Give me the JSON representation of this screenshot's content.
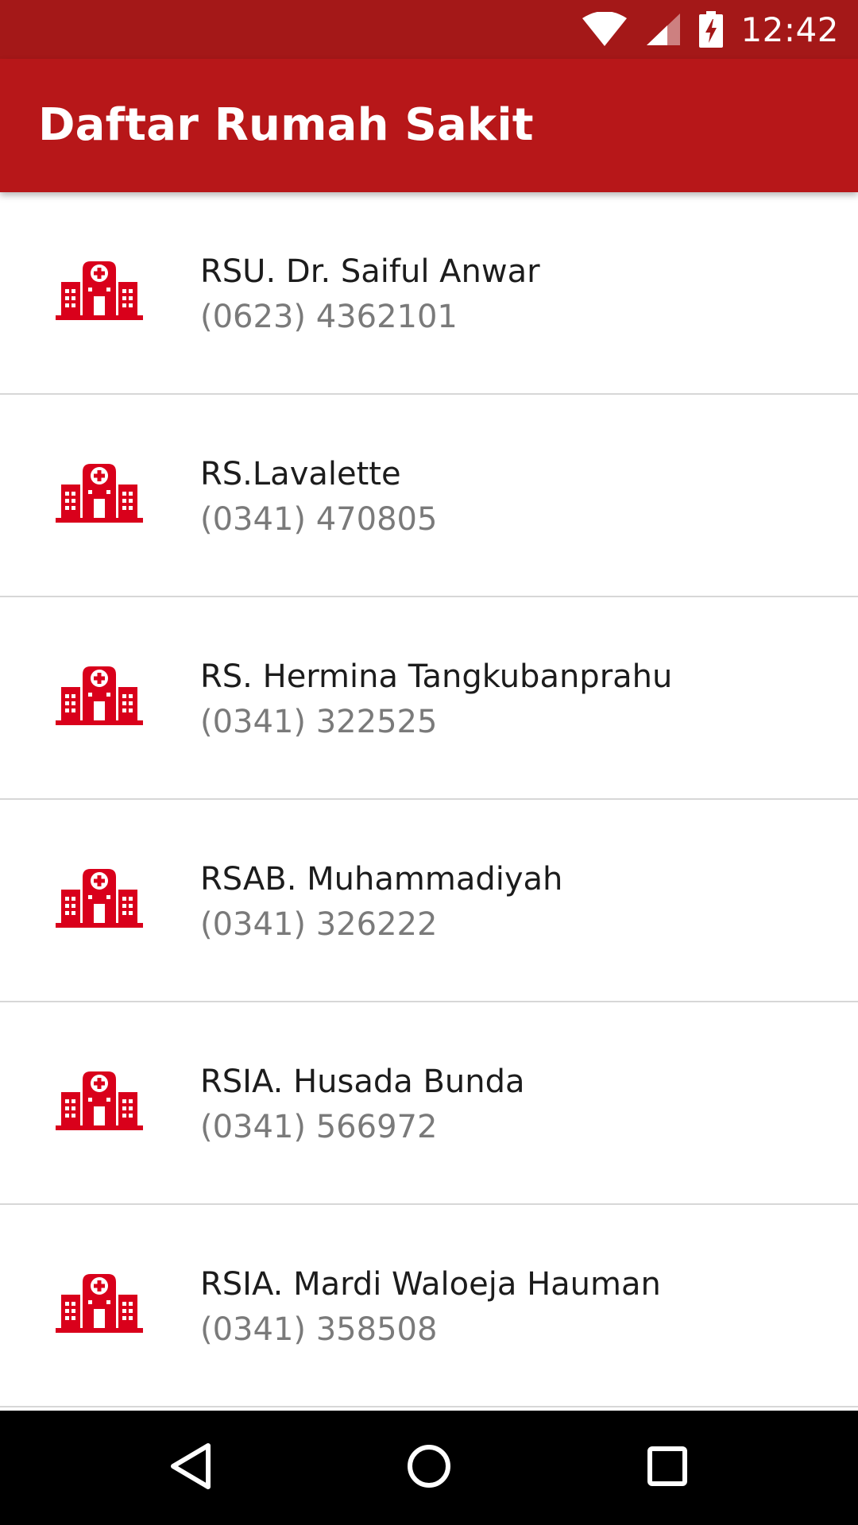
{
  "status_bar": {
    "time": "12:42",
    "icons": [
      "wifi-icon",
      "cell-signal-icon",
      "battery-charging-icon"
    ],
    "background": "#A41818"
  },
  "app_bar": {
    "title": "Daftar Rumah Sakit",
    "background": "#B71719"
  },
  "hospitals": [
    {
      "name": "RSU. Dr. Saiful Anwar",
      "phone": "(0623) 4362101",
      "icon": "hospital-icon"
    },
    {
      "name": "RS.Lavalette",
      "phone": "(0341) 470805",
      "icon": "hospital-icon"
    },
    {
      "name": "RS. Hermina Tangkubanprahu",
      "phone": "(0341) 322525",
      "icon": "hospital-icon"
    },
    {
      "name": "RSAB. Muhammadiyah",
      "phone": "(0341) 326222",
      "icon": "hospital-icon"
    },
    {
      "name": "RSIA. Husada Bunda",
      "phone": "(0341) 566972",
      "icon": "hospital-icon"
    },
    {
      "name": "RSIA. Mardi Waloeja Hauman",
      "phone": "(0341) 358508",
      "icon": "hospital-icon"
    }
  ],
  "nav_bar": {
    "buttons": [
      "back-icon",
      "home-icon",
      "recents-icon"
    ]
  },
  "colors": {
    "accent": "#D9001B",
    "name_text": "#1C1C1C",
    "phone_text": "#7A7A7A",
    "divider": "#D7D7D7"
  }
}
